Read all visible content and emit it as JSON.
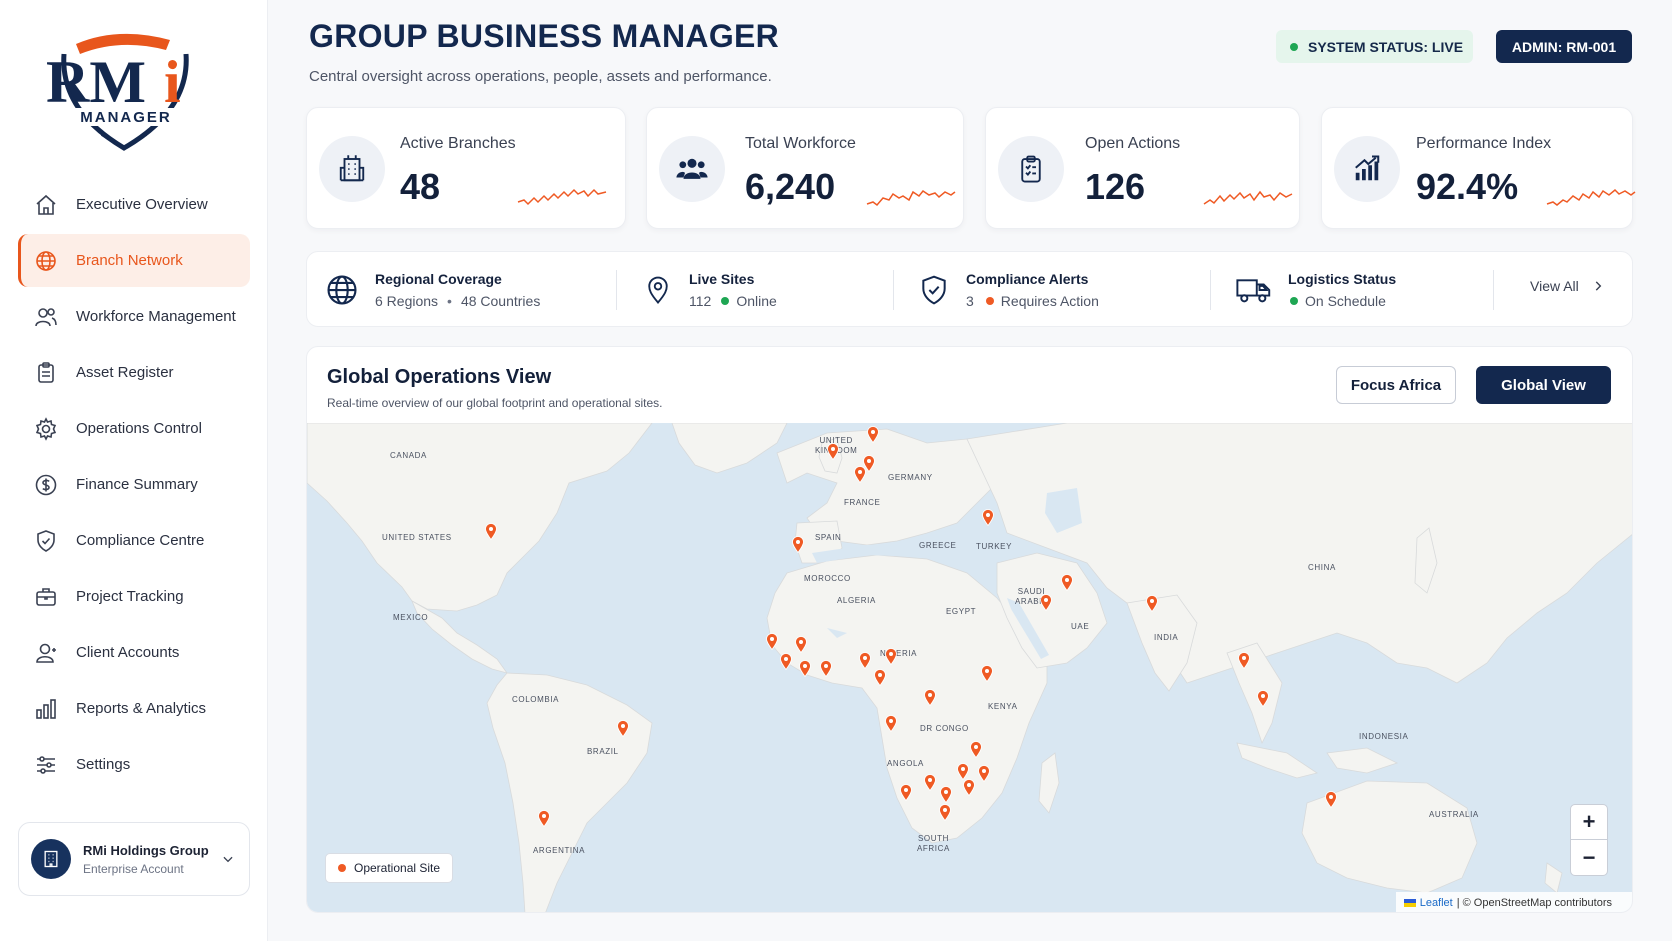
{
  "brand": {
    "logo_text": "RMi",
    "logo_sub": "MANAGER"
  },
  "sidebar": {
    "items": [
      {
        "label": "Executive Overview",
        "icon": "home-icon"
      },
      {
        "label": "Branch Network",
        "icon": "globe-icon",
        "active": true
      },
      {
        "label": "Workforce Management",
        "icon": "users-icon"
      },
      {
        "label": "Asset Register",
        "icon": "clipboard-icon"
      },
      {
        "label": "Operations Control",
        "icon": "gear-icon"
      },
      {
        "label": "Finance Summary",
        "icon": "dollar-icon"
      },
      {
        "label": "Compliance Centre",
        "icon": "shield-icon"
      },
      {
        "label": "Project Tracking",
        "icon": "briefcase-icon"
      },
      {
        "label": "Client Accounts",
        "icon": "user-icon"
      },
      {
        "label": "Reports & Analytics",
        "icon": "bar-chart-icon"
      },
      {
        "label": "Settings",
        "icon": "sliders-icon"
      }
    ],
    "account": {
      "name": "RMi Holdings Group",
      "type": "Enterprise Account"
    }
  },
  "header": {
    "title": "GROUP BUSINESS MANAGER",
    "subtitle": "Central oversight across operations, people, assets and performance.",
    "system_status": "SYSTEM STATUS: LIVE",
    "admin": "ADMIN: RM-001"
  },
  "kpis": [
    {
      "label": "Active Branches",
      "value": "48",
      "icon": "building-icon"
    },
    {
      "label": "Total Workforce",
      "value": "6,240",
      "icon": "team-icon"
    },
    {
      "label": "Open Actions",
      "value": "126",
      "icon": "checklist-icon"
    },
    {
      "label": "Performance Index",
      "value": "92.4%",
      "icon": "growth-chart-icon"
    }
  ],
  "strip": {
    "regional": {
      "title": "Regional Coverage",
      "regions": "6 Regions",
      "countries": "48 Countries"
    },
    "sites": {
      "title": "Live Sites",
      "count": "112",
      "status": "Online"
    },
    "compliance": {
      "title": "Compliance Alerts",
      "count": "3",
      "status": "Requires Action"
    },
    "logistics": {
      "title": "Logistics Status",
      "status": "On Schedule"
    },
    "view_all": "View All"
  },
  "map": {
    "title": "Global Operations View",
    "subtitle": "Real-time overview of our global footprint and operational sites.",
    "focus_label": "Focus Africa",
    "global_label": "Global View",
    "legend": "Operational Site",
    "zoom_in": "+",
    "zoom_out": "−",
    "attribution_link": "Leaflet",
    "attribution_text": "| © OpenStreetMap contributors",
    "countries": {
      "canada": "CANADA",
      "united_states": "UNITED STATES",
      "mexico": "MEXICO",
      "colombia": "COLOMBIA",
      "brazil": "BRAZIL",
      "argentina": "ARGENTINA",
      "united_kingdom_1": "UNITED",
      "united_kingdom_2": "KINGDOM",
      "germany": "GERMANY",
      "france": "FRANCE",
      "spain": "SPAIN",
      "greece": "GREECE",
      "turkey": "TURKEY",
      "morocco": "MOROCCO",
      "algeria": "ALGERIA",
      "egypt": "EGYPT",
      "saudi_1": "SAUDI",
      "saudi_2": "ARABIA",
      "uae": "UAE",
      "nigeria": "NIGERIA",
      "kenya": "KENYA",
      "dr_congo": "DR CONGO",
      "angola": "ANGOLA",
      "south_africa_1": "SOUTH",
      "south_africa_2": "AFRICA",
      "india": "INDIA",
      "china": "CHINA",
      "indonesia": "INDONESIA",
      "australia": "AUSTRALIA"
    }
  },
  "colors": {
    "navy": "#13284e",
    "accent": "#e8561c",
    "pin": "#ef5a24",
    "online": "#1ea653"
  }
}
